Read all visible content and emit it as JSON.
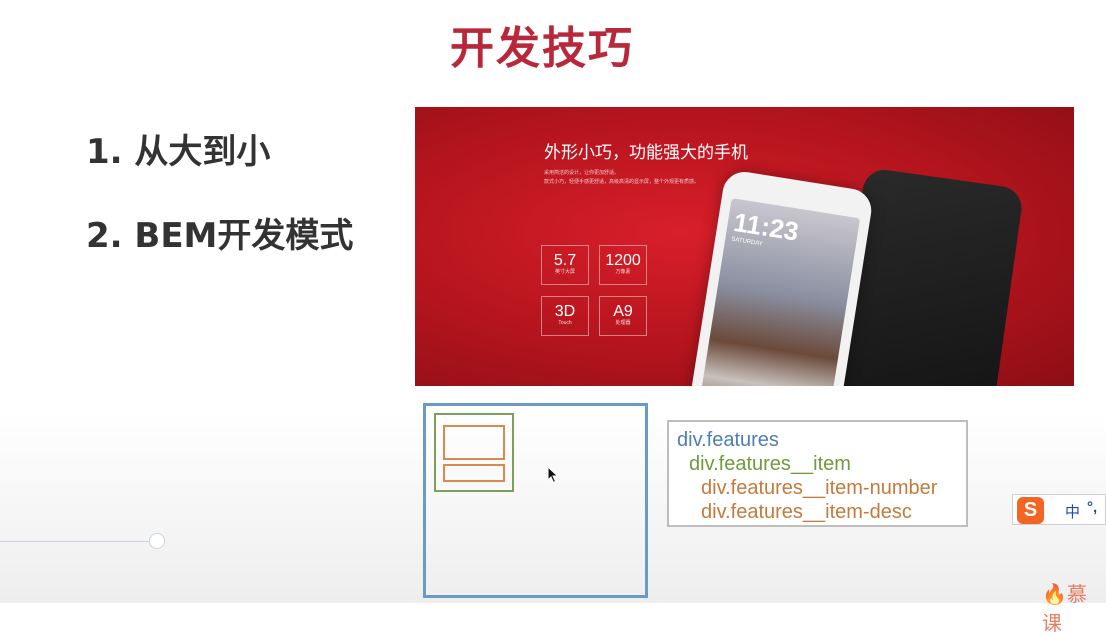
{
  "slide": {
    "title": "开发技巧",
    "bullets": [
      "1. 从大到小",
      "2. BEM开发模式"
    ]
  },
  "banner": {
    "headline": "外形小巧，功能强大的手机",
    "subtext": "采用简洁的设计，让你更加舒适。\n款式小巧，轻便手感更舒适，高级高清的显示屏，整个外观更有质感。",
    "features": [
      {
        "number": "5.7",
        "desc": "英寸大屏"
      },
      {
        "number": "1200",
        "desc": "万像素"
      },
      {
        "number": "3D",
        "desc": "Touch"
      },
      {
        "number": "A9",
        "desc": "处理器"
      }
    ],
    "phone": {
      "time": "11:23",
      "day": "SATURDAY"
    }
  },
  "code": {
    "lines": [
      "div.features",
      "div.features__item",
      "div.features__item-number",
      "div.features__item-desc"
    ]
  },
  "ime": {
    "logo": "S",
    "mode": "中",
    "punct": "°,"
  },
  "watermark": "慕课",
  "colors": {
    "title": "#b8283a",
    "banner": "#c4161f",
    "outer_box": "#6c9ac7",
    "green_box": "#7aa05a",
    "orange_box": "#d98a4f",
    "code_block": "#4e7fb3",
    "code_element": "#6f9b3c",
    "code_modifier": "#c47a3c"
  }
}
